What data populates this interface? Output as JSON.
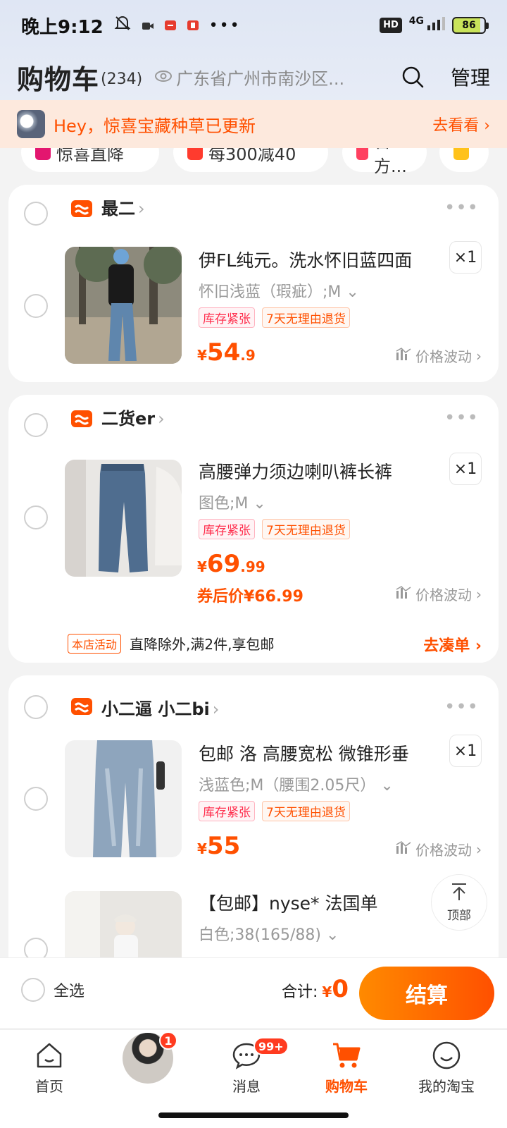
{
  "status": {
    "time": "晚上9:12",
    "network": "4G",
    "hd": "HD",
    "battery": "86"
  },
  "header": {
    "title": "购物车",
    "count": "(234)",
    "location": "广东省广州市南沙区...",
    "manage": "管理"
  },
  "banner": {
    "text": "Hey，惊喜宝藏种草已更新",
    "action": "去看看"
  },
  "chips": [
    "惊喜直降",
    "每300减40",
    "官方..."
  ],
  "shops": [
    {
      "name": "最二",
      "items": [
        {
          "title": "伊FL纯元。洗水怀旧蓝四面",
          "sku": "怀旧浅蓝（瑕疵）;M",
          "qty": "×1",
          "tags": [
            "库存紧张",
            "7天无理由退货"
          ],
          "price_symbol": "¥",
          "price_int": "54",
          "price_dec": ".9",
          "trend": "价格波动"
        }
      ]
    },
    {
      "name": "二货er",
      "items": [
        {
          "title": "高腰弹力须边喇叭裤长裤",
          "sku": "图色;M",
          "qty": "×1",
          "tags": [
            "库存紧张",
            "7天无理由退货"
          ],
          "price_symbol": "¥",
          "price_int": "69",
          "price_dec": ".99",
          "coupon_price": "券后价¥66.99",
          "trend": "价格波动"
        }
      ],
      "promo": {
        "tag": "本店活动",
        "text": "直降除外,满2件,享包邮",
        "action": "去凑单 ›"
      }
    },
    {
      "name": "小二逼 小二bi",
      "items": [
        {
          "title": "包邮 洛 高腰宽松 微锥形垂",
          "sku": "浅蓝色;M（腰围2.05尺）",
          "qty": "×1",
          "tags": [
            "库存紧张",
            "7天无理由退货"
          ],
          "price_symbol": "¥",
          "price_int": "55",
          "price_dec": "",
          "trend": "价格波动"
        },
        {
          "title": "【包邮】nyse* 法国单",
          "sku": "白色;38(165/88)"
        }
      ]
    }
  ],
  "to_top": "顶部",
  "bottom": {
    "select_all": "全选",
    "total_label": "合计:",
    "total_symbol": "¥",
    "total_value": "0",
    "checkout": "结算"
  },
  "tabs": [
    {
      "label": "首页"
    },
    {
      "label": "",
      "badge": "1"
    },
    {
      "label": "消息",
      "badge": "99+"
    },
    {
      "label": "购物车",
      "active": true
    },
    {
      "label": "我的淘宝"
    }
  ],
  "colors": {
    "accent": "#ff5000",
    "tag_red": "#ff2e4d"
  }
}
